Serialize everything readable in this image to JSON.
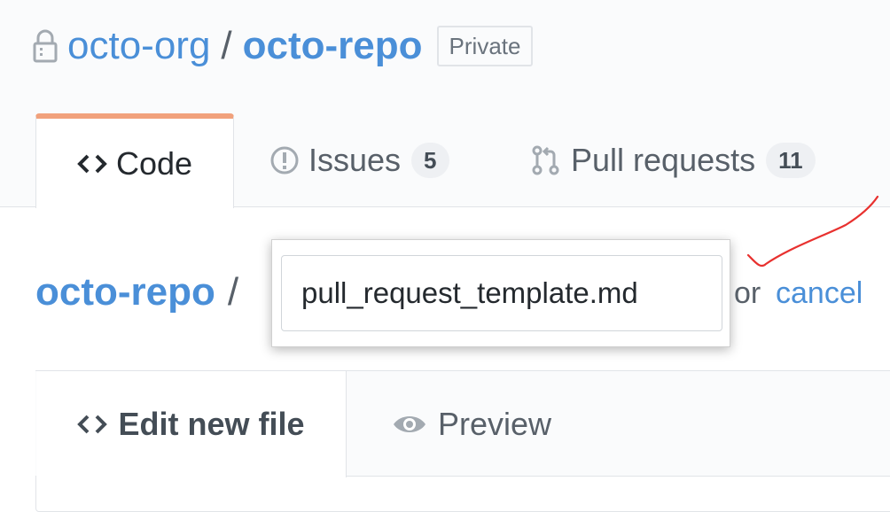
{
  "repo": {
    "owner": "octo-org",
    "separator": "/",
    "name": "octo-repo",
    "visibility": "Private"
  },
  "tabs": [
    {
      "label": "Code",
      "icon": "code-icon",
      "selected": true
    },
    {
      "label": "Issues",
      "icon": "issue-opened-icon",
      "count": "5"
    },
    {
      "label": "Pull requests",
      "icon": "git-pull-request-icon",
      "count": "11"
    }
  ],
  "breadcrumb": {
    "repo": "octo-repo",
    "separator": "/"
  },
  "filename": {
    "value": "pull_request_template.md"
  },
  "cancel": {
    "or": "or",
    "link": "cancel"
  },
  "editor": {
    "tabs": [
      {
        "label": "Edit new file",
        "icon": "code-icon",
        "selected": true
      },
      {
        "label": "Preview",
        "icon": "eye-icon"
      }
    ]
  },
  "colors": {
    "link": "#4a8fd8",
    "selected_tab_accent": "#f1a17c",
    "annotation": "#e8312f"
  }
}
